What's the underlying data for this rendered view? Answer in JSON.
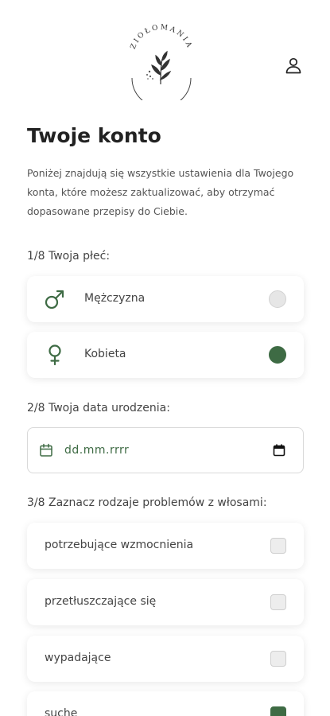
{
  "brand": {
    "logo_text": "ZIOŁOMANIA"
  },
  "header": {
    "account_icon": "user-icon"
  },
  "page": {
    "title": "Twoje konto",
    "intro": "Poniżej znajdują się wszystkie ustawienia dla Twojego konta, które możesz zaktualizować, aby otrzymać dopasowane przepisy do Ciebie."
  },
  "gender": {
    "label": "1/8 Twoja płeć:",
    "options": [
      {
        "label": "Mężczyzna",
        "icon": "male-symbol-icon",
        "selected": false
      },
      {
        "label": "Kobieta",
        "icon": "female-symbol-icon",
        "selected": true
      }
    ]
  },
  "birthdate": {
    "label": "2/8 Twoja data urodzenia:",
    "placeholder": "dd.mm.rrrr",
    "icon": "calendar-icon"
  },
  "hair_problems": {
    "label": "3/8 Zaznacz rodzaje problemów z włosami:",
    "options": [
      {
        "label": "potrzebujące wzmocnienia",
        "checked": false
      },
      {
        "label": "przetłuszczające się",
        "checked": false
      },
      {
        "label": "wypadające",
        "checked": false
      },
      {
        "label": "suche",
        "checked": true
      }
    ]
  },
  "colors": {
    "accent": "#3e6b44",
    "text": "#333333",
    "muted": "#555555"
  }
}
